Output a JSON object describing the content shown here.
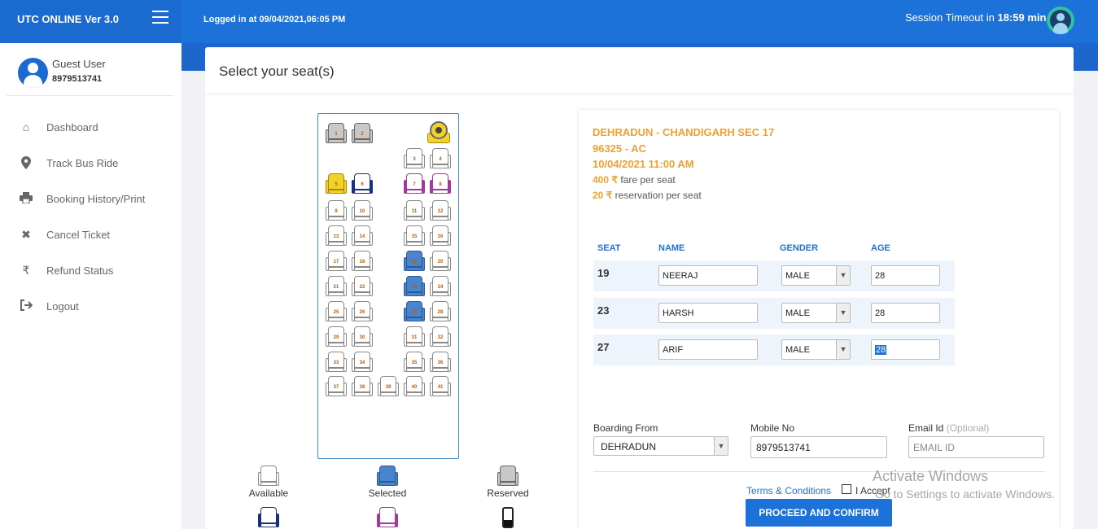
{
  "app": {
    "title": "UTC ONLINE Ver 3.0",
    "logged_in": "Logged in at 09/04/2021,06:05 PM",
    "session_prefix": "Session Timeout in",
    "session_time": "18:59 min"
  },
  "user": {
    "name": "Guest User",
    "phone": "8979513741"
  },
  "sidebar": {
    "items": [
      {
        "label": "Dashboard",
        "icon": "home-icon"
      },
      {
        "label": "Track Bus Ride",
        "icon": "map-pin-icon"
      },
      {
        "label": "Booking History/Print",
        "icon": "printer-icon"
      },
      {
        "label": "Cancel Ticket",
        "icon": "close-icon"
      },
      {
        "label": "Refund Status",
        "icon": "rupee-icon"
      },
      {
        "label": "Logout",
        "icon": "logout-icon"
      }
    ]
  },
  "page": {
    "title": "Select your seat(s)"
  },
  "seats": {
    "labels": [
      "1",
      "2",
      "3",
      "4",
      "5",
      "6",
      "7",
      "8",
      "9",
      "10",
      "11",
      "12",
      "13",
      "14",
      "15",
      "16",
      "17",
      "18",
      "19",
      "20",
      "21",
      "22",
      "23",
      "24",
      "25",
      "26",
      "27",
      "28",
      "29",
      "30",
      "31",
      "32",
      "33",
      "34",
      "35",
      "36",
      "37",
      "38",
      "39",
      "40",
      "41"
    ],
    "reserved": [
      "1",
      "2"
    ],
    "selected": [
      "19",
      "23",
      "27"
    ],
    "ladies": [
      "7",
      "8"
    ],
    "gents": [
      "6"
    ],
    "yellow": [
      "5"
    ]
  },
  "legend": {
    "available": "Available",
    "selected": "Selected",
    "reserved": "Reserved"
  },
  "trip": {
    "route": "DEHRADUN - CHANDIGARH SEC 17",
    "service": "96325 - AC",
    "datetime": "10/04/2021 11:00 AM",
    "fare_amount": "400 ₹",
    "fare_text": "fare per seat",
    "reservation_amount": "20 ₹",
    "reservation_text": "reservation per seat"
  },
  "passengers": {
    "headers": {
      "seat": "SEAT",
      "name": "NAME",
      "gender": "GENDER",
      "age": "AGE"
    },
    "rows": [
      {
        "seat": "19",
        "name": "NEERAJ",
        "gender": "MALE",
        "age": "28"
      },
      {
        "seat": "23",
        "name": "HARSH",
        "gender": "MALE",
        "age": "28"
      },
      {
        "seat": "27",
        "name": "ARIF",
        "gender": "MALE",
        "age": "28"
      }
    ]
  },
  "form": {
    "boarding_label": "Boarding From",
    "boarding_value": "DEHRADUN",
    "mobile_label": "Mobile No",
    "mobile_value": "8979513741",
    "email_label": "Email Id",
    "email_optional": "(Optional)",
    "email_placeholder": "EMAIL ID",
    "terms": "Terms & Conditions",
    "accept": "I Accept",
    "proceed": "PROCEED AND CONFIRM"
  },
  "watermark": {
    "line1": "Activate Windows",
    "line2": "Go to Settings to activate Windows."
  }
}
